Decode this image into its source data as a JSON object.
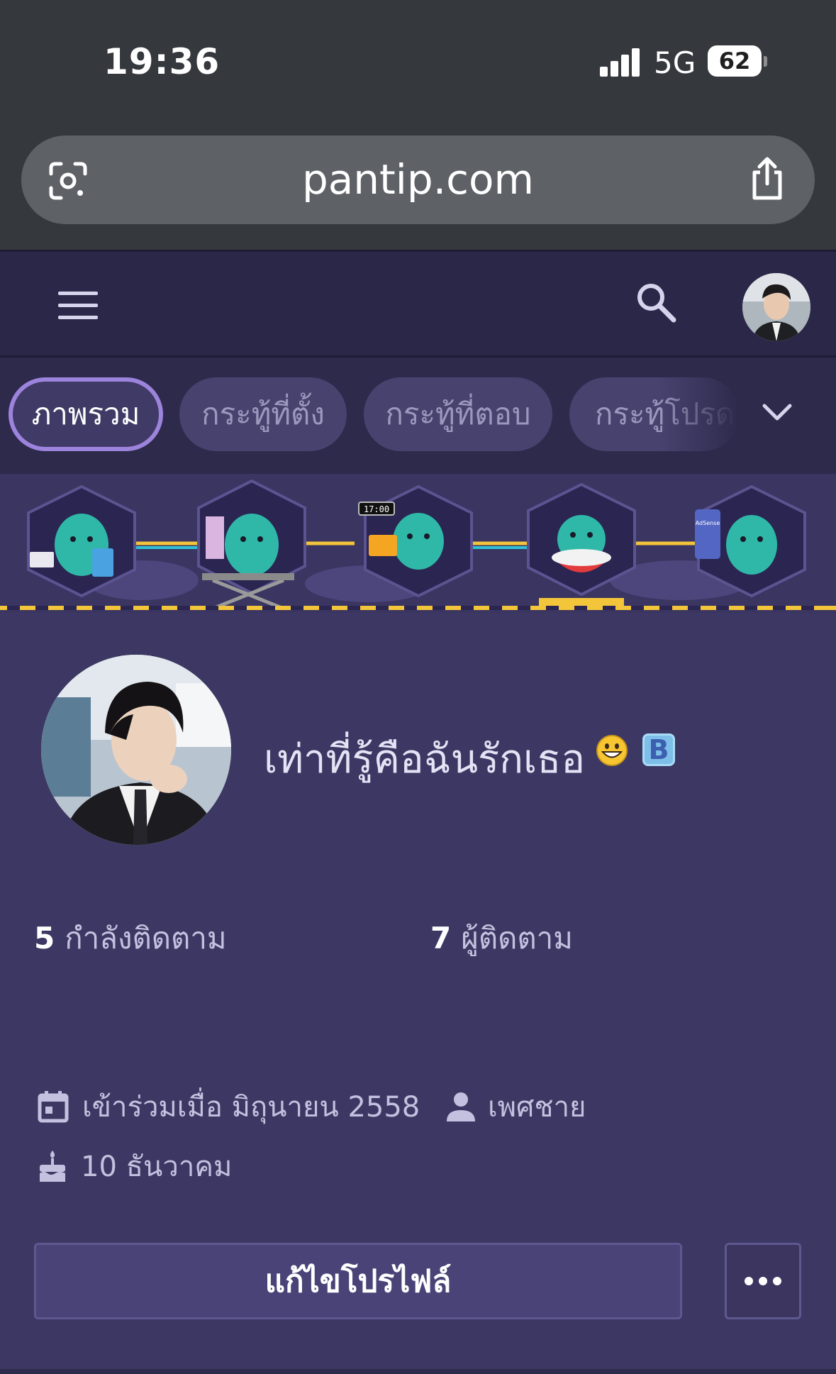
{
  "status_bar": {
    "time": "19:36",
    "network": "5G",
    "battery": "62"
  },
  "browser": {
    "url": "pantip.com",
    "left_icon": "google-lens-icon",
    "right_icon": "share-icon"
  },
  "header": {
    "menu_icon": "hamburger-menu-icon",
    "search_icon": "search-icon",
    "avatar": "user-avatar"
  },
  "tabs": [
    {
      "label": "ภาพรวม",
      "active": true
    },
    {
      "label": "กระทู้ที่ตั้ง",
      "active": false
    },
    {
      "label": "กระทู้ที่ตอบ",
      "active": false
    },
    {
      "label": "กระทู้โปรด",
      "active": false
    }
  ],
  "banner": {
    "clock_text": "17:00",
    "adsense_text": "AdSense"
  },
  "profile": {
    "name": "เท่าที่รู้คือฉันรักเธอ",
    "badge": "B",
    "following_count": "5",
    "following_label": "กำลังติดตาม",
    "followers_count": "7",
    "followers_label": "ผู้ติดตาม",
    "joined": "เข้าร่วมเมื่อ มิถุนายน 2558",
    "gender": "เพศชาย",
    "birthday": "10 ธันวาคม",
    "edit_button": "แก้ไขโปรไฟล์"
  },
  "colors": {
    "page_bg": "#3d3863",
    "header_bg": "#2b2748",
    "tab_active_border": "#9c83dc",
    "chrome_bg": "#35383d"
  }
}
